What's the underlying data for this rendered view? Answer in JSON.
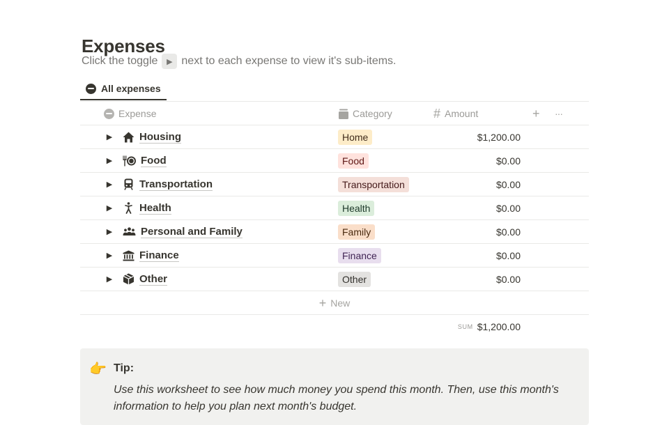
{
  "page": {
    "title": "Expenses",
    "description_before": "Click the toggle",
    "description_key": "▶",
    "description_after": "next to each expense to view it's sub-items."
  },
  "view_tab": {
    "label": "All expenses"
  },
  "table": {
    "columns": {
      "expense": "Expense",
      "category": "Category",
      "amount": "Amount"
    },
    "add_column_icon": "+",
    "more_icon": "···",
    "rows": [
      {
        "toggle": "▶",
        "icon": "house-icon",
        "name": "Housing",
        "category": "Home",
        "cat_bg": "#fdecc8",
        "cat_fg": "#402c1b",
        "amount": "$1,200.00"
      },
      {
        "toggle": "▶",
        "icon": "fork-plate-icon",
        "name": "Food",
        "category": "Food",
        "cat_bg": "#ffe2dd",
        "cat_fg": "#5d1715",
        "amount": "$0.00"
      },
      {
        "toggle": "▶",
        "icon": "train-icon",
        "name": "Transportation",
        "category": "Transportation",
        "cat_bg": "#f4dfd9",
        "cat_fg": "#44191a",
        "amount": "$0.00"
      },
      {
        "toggle": "▶",
        "icon": "person-icon",
        "name": "Health",
        "category": "Health",
        "cat_bg": "#dbeddb",
        "cat_fg": "#1c3829",
        "amount": "$0.00"
      },
      {
        "toggle": "▶",
        "icon": "people-icon",
        "name": "Personal and Family",
        "category": "Family",
        "cat_bg": "#fadec9",
        "cat_fg": "#49290e",
        "amount": "$0.00"
      },
      {
        "toggle": "▶",
        "icon": "bank-icon",
        "name": "Finance",
        "category": "Finance",
        "cat_bg": "#e8deee",
        "cat_fg": "#412454",
        "amount": "$0.00"
      },
      {
        "toggle": "▶",
        "icon": "box-icon",
        "name": "Other",
        "category": "Other",
        "cat_bg": "#e3e2e0",
        "cat_fg": "#32302c",
        "amount": "$0.00"
      }
    ],
    "new_plus": "+",
    "new_label": "New",
    "sum_label": "SUM",
    "sum_value": "$1,200.00"
  },
  "callout": {
    "icon": "pointing-hand-icon",
    "glyph": "👉",
    "title": "Tip:",
    "body": "Use this worksheet to see how much money you spend this month. Then, use this month's information to help you plan next month's budget."
  }
}
